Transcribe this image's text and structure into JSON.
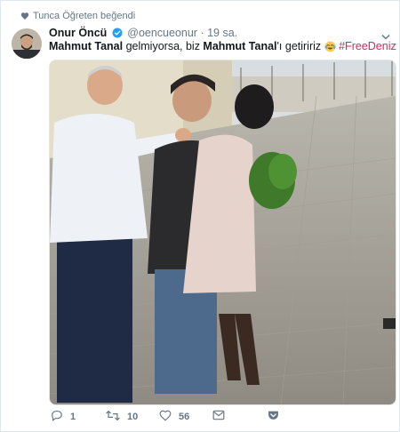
{
  "social_context": {
    "text": "Tunca Öğreten beğendi",
    "icon": "heart-icon"
  },
  "tweet": {
    "author_name": "Onur Öncü",
    "handle": "@oencueonur",
    "dot": "·",
    "time": "19 sa.",
    "text_parts": {
      "bold1": "Mahmut Tanal",
      "plain1": " gelmiyorsa, biz ",
      "bold2": "Mahmut Tanal",
      "plain2": "'ı getiririz ",
      "hashtag": "#FreeDeniz"
    },
    "emoji": "tears-of-joy-emoji"
  },
  "actions": {
    "reply_count": "1",
    "retweet_count": "10",
    "like_count": "56"
  },
  "colors": {
    "hashtag": "#e0245e",
    "secondary_text": "#657786",
    "verified": "#1da1f2"
  }
}
